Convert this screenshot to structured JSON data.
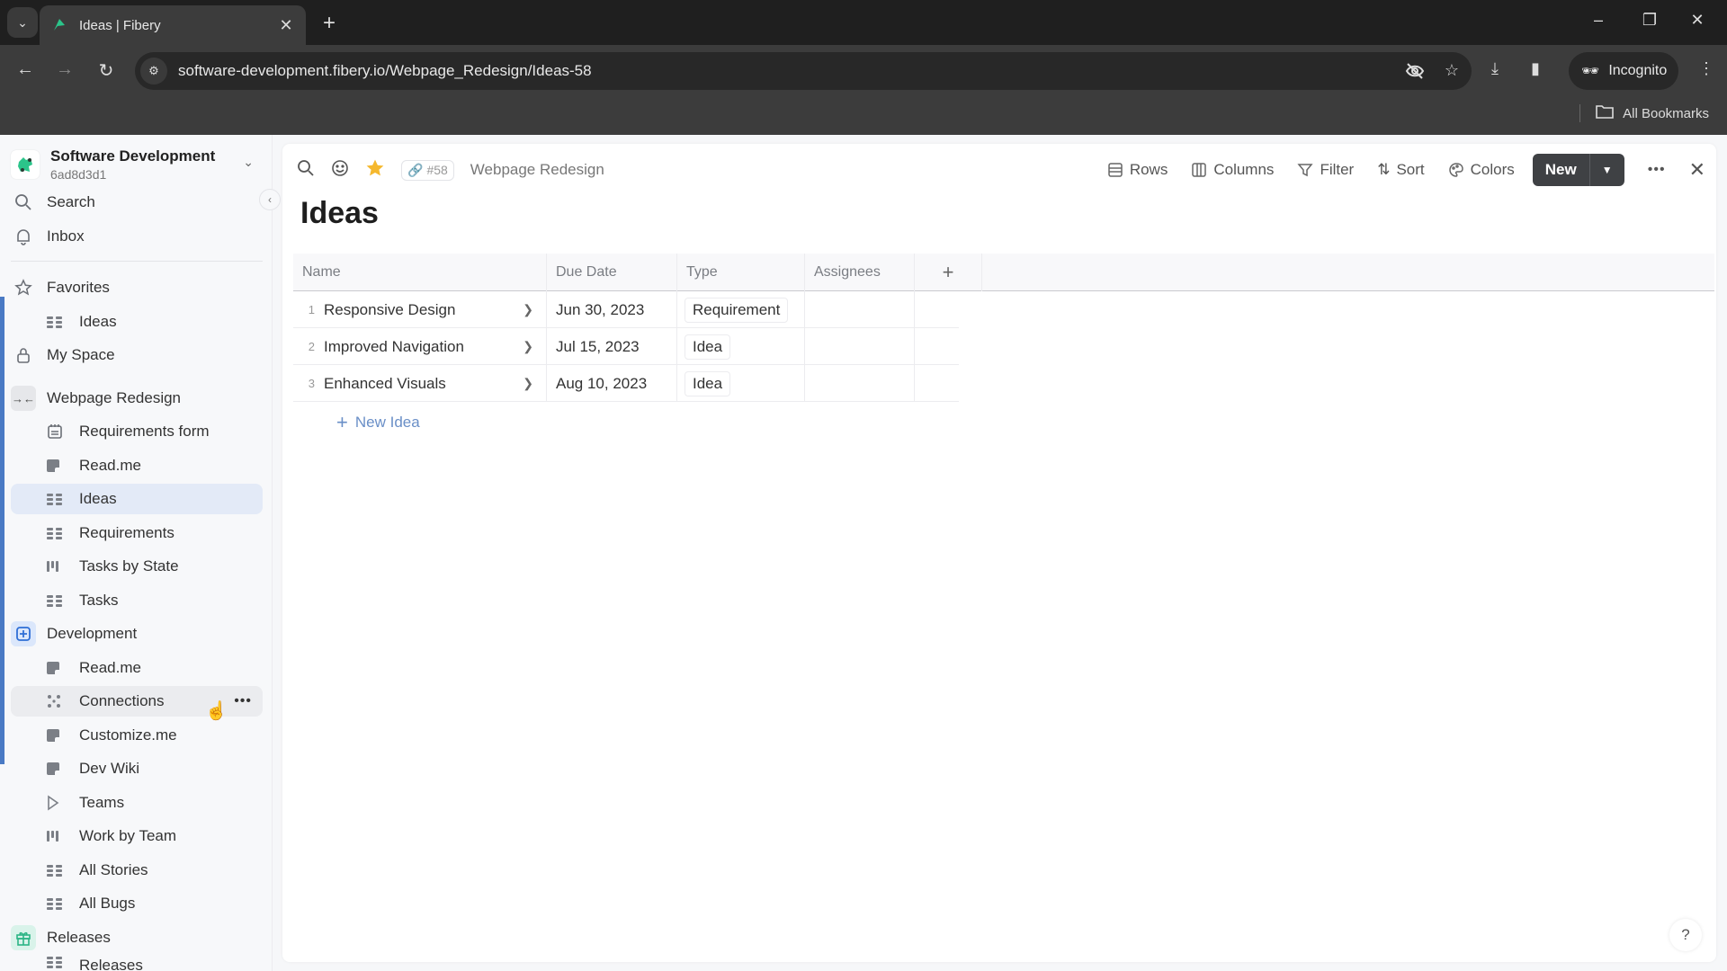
{
  "browser": {
    "tab_title": "Ideas | Fibery",
    "url": "software-development.fibery.io/Webpage_Redesign/Ideas-58",
    "incognito_label": "Incognito",
    "bookmarks_label": "All Bookmarks"
  },
  "workspace": {
    "name": "Software Development",
    "id": "6ad8d3d1"
  },
  "sidebar": {
    "search": "Search",
    "inbox": "Inbox",
    "favorites": "Favorites",
    "favorites_items": [
      {
        "label": "Ideas",
        "icon": "table-icon"
      }
    ],
    "my_space": "My Space",
    "spaces": [
      {
        "label": "Webpage Redesign",
        "icon": "arrows-inward-icon",
        "items": [
          {
            "label": "Requirements form",
            "icon": "form-icon"
          },
          {
            "label": "Read.me",
            "icon": "document-icon"
          },
          {
            "label": "Ideas",
            "icon": "table-icon",
            "active": true
          },
          {
            "label": "Requirements",
            "icon": "table-icon"
          },
          {
            "label": "Tasks by State",
            "icon": "board-icon"
          },
          {
            "label": "Tasks",
            "icon": "table-icon"
          }
        ]
      },
      {
        "label": "Development",
        "icon": "plus-box-icon",
        "items": [
          {
            "label": "Read.me",
            "icon": "document-icon"
          },
          {
            "label": "Connections",
            "icon": "connections-icon",
            "hover": true
          },
          {
            "label": "Customize.me",
            "icon": "document-icon"
          },
          {
            "label": "Dev Wiki",
            "icon": "document-icon"
          },
          {
            "label": "Teams",
            "icon": "play-outline-icon"
          },
          {
            "label": "Work by Team",
            "icon": "board-icon"
          },
          {
            "label": "All Stories",
            "icon": "table-icon"
          },
          {
            "label": "All Bugs",
            "icon": "table-icon"
          }
        ]
      },
      {
        "label": "Releases",
        "icon": "gift-icon",
        "items": [
          {
            "label": "Releases",
            "icon": "table-icon"
          }
        ]
      }
    ]
  },
  "main": {
    "badge_number": "#58",
    "breadcrumb": "Webpage Redesign",
    "title": "Ideas",
    "actions": {
      "rows": "Rows",
      "columns": "Columns",
      "filter": "Filter",
      "sort": "Sort",
      "colors": "Colors",
      "new": "New"
    },
    "table": {
      "columns": [
        "Name",
        "Due Date",
        "Type",
        "Assignees"
      ],
      "rows": [
        {
          "num": "1",
          "name": "Responsive Design",
          "due": "Jun 30, 2023",
          "type": "Requirement",
          "assignees": ""
        },
        {
          "num": "2",
          "name": "Improved Navigation",
          "due": "Jul 15, 2023",
          "type": "Idea",
          "assignees": ""
        },
        {
          "num": "3",
          "name": "Enhanced Visuals",
          "due": "Aug 10, 2023",
          "type": "Idea",
          "assignees": ""
        }
      ],
      "new_row_label": "New Idea"
    },
    "help_label": "?"
  },
  "colors": {
    "accent": "#4a7ac4",
    "active_item_bg": "#e3eaf7",
    "new_button_bg": "#3f4144",
    "star": "#f5b82e",
    "fibery_green": "#2bc48a"
  }
}
